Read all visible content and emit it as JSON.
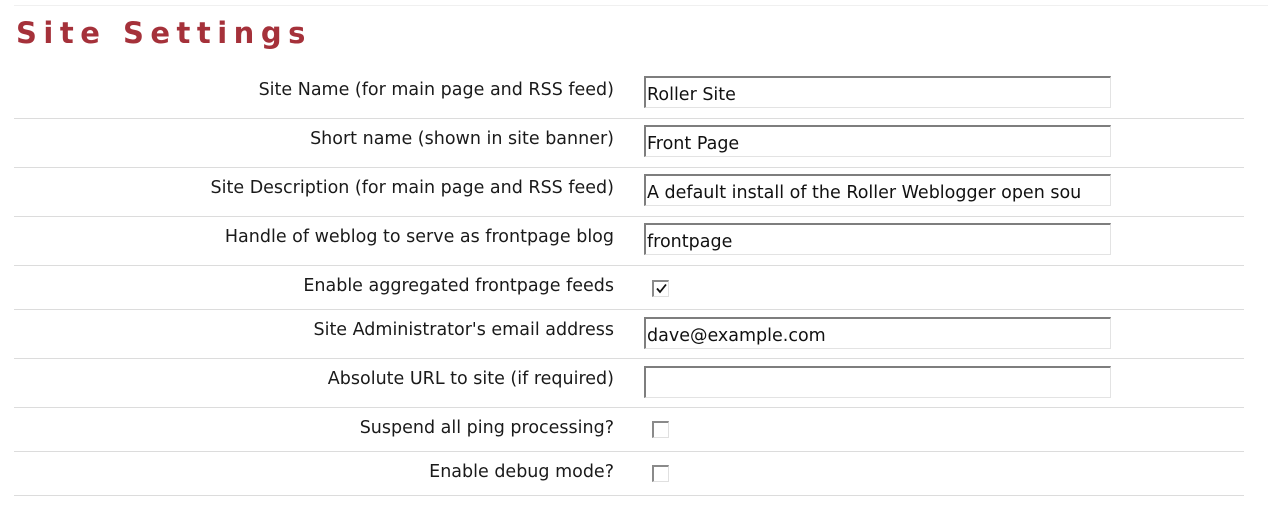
{
  "page": {
    "title": "Site Settings"
  },
  "settings": [
    {
      "id": "site-name",
      "label": "Site Name (for main page and RSS feed)",
      "type": "text",
      "value": "Roller Site"
    },
    {
      "id": "short-name",
      "label": "Short name (shown in site banner)",
      "type": "text",
      "value": "Front Page"
    },
    {
      "id": "site-description",
      "label": "Site Description (for main page and RSS feed)",
      "type": "text",
      "value": "A default install of the Roller Weblogger open sou"
    },
    {
      "id": "frontpage-handle",
      "label": "Handle of weblog to serve as frontpage blog",
      "type": "text",
      "value": "frontpage"
    },
    {
      "id": "aggregated-feeds",
      "label": "Enable aggregated frontpage feeds",
      "type": "checkbox",
      "checked": true
    },
    {
      "id": "admin-email",
      "label": "Site Administrator's email address",
      "type": "text",
      "value": "dave@example.com"
    },
    {
      "id": "absolute-url",
      "label": "Absolute URL to site (if required)",
      "type": "text",
      "value": ""
    },
    {
      "id": "suspend-ping",
      "label": "Suspend all ping processing?",
      "type": "checkbox",
      "checked": false
    },
    {
      "id": "debug-mode",
      "label": "Enable debug mode?",
      "type": "checkbox",
      "checked": false
    }
  ],
  "colors": {
    "title": "#a5313a",
    "row_divider": "#dcdcdc",
    "field_border_dark": "#7e7e7e"
  }
}
